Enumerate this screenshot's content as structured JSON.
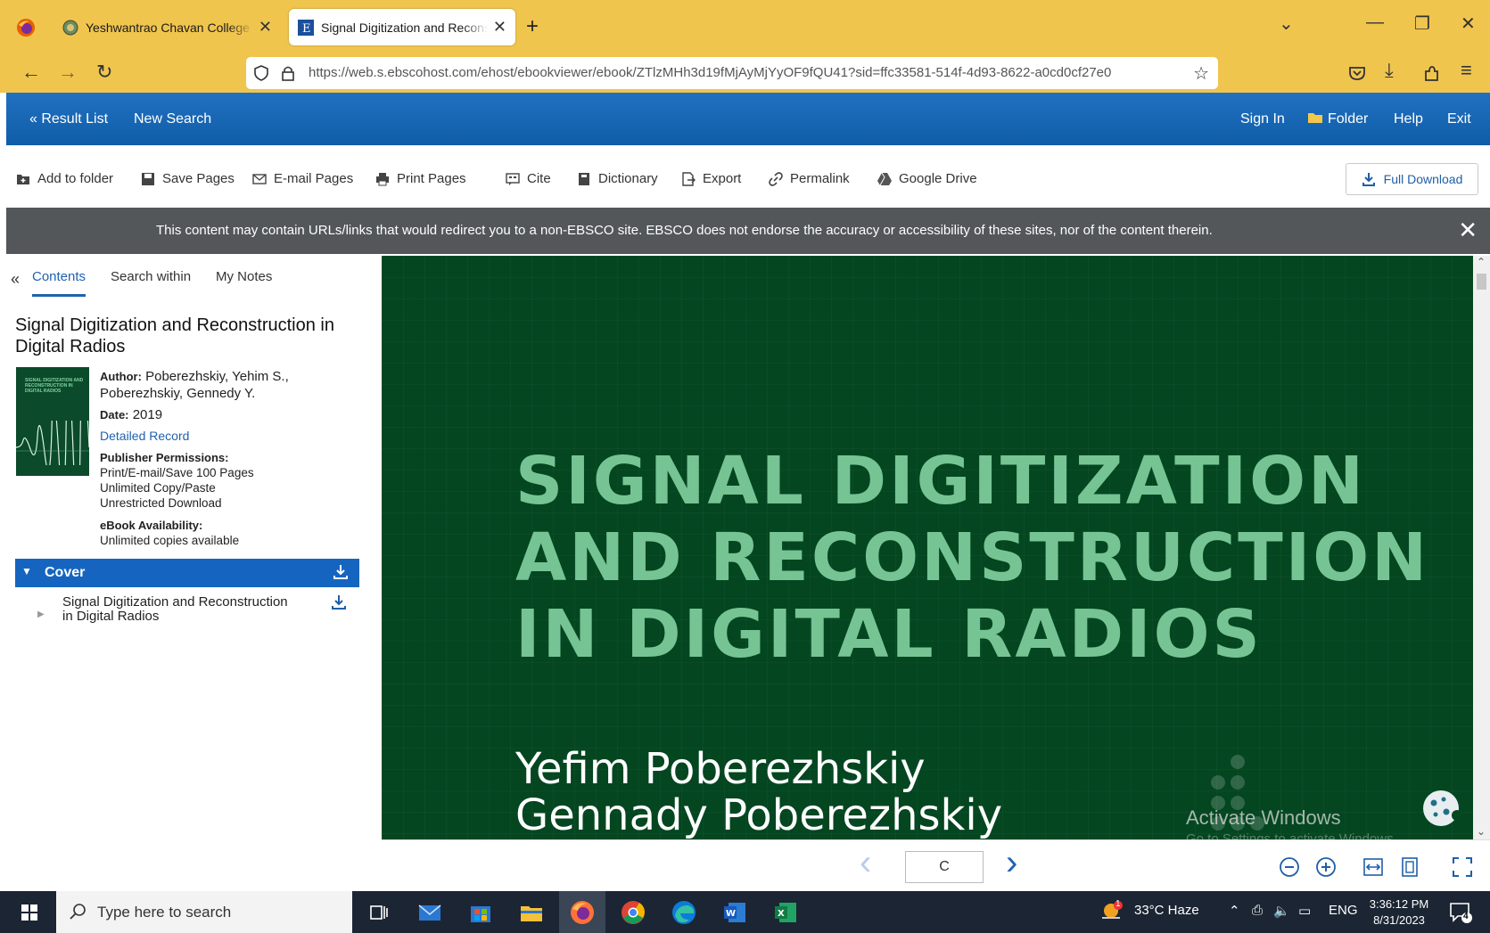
{
  "browser": {
    "tabs": [
      {
        "title": "Yeshwantrao Chavan College of Engineering",
        "active": false
      },
      {
        "title": "Signal Digitization and Reconstruction in Digital Radios",
        "active": true
      }
    ],
    "url": "https://web.s.ebscohost.com/ehost/ebookviewer/ebook/ZTlzMHh3d19fMjAyMjYyOF9fQU41?sid=ffc33581-514f-4d93-8622-a0cd0cf27e0"
  },
  "ebsco_header": {
    "result_list": "« Result List",
    "new_search": "New Search",
    "sign_in": "Sign In",
    "folder": "Folder",
    "help": "Help",
    "exit": "Exit"
  },
  "toolbar": {
    "add_to_folder": "Add to folder",
    "save_pages": "Save Pages",
    "email_pages": "E-mail Pages",
    "print_pages": "Print Pages",
    "cite": "Cite",
    "dictionary": "Dictionary",
    "export": "Export",
    "permalink": "Permalink",
    "google_drive": "Google Drive",
    "full_download": "Full Download"
  },
  "notice": "This content may contain URLs/links that would redirect you to a non-EBSCO site. EBSCO does not endorse the accuracy or accessibility of these sites, nor of the content therein.",
  "panel": {
    "tabs": [
      "Contents",
      "Search within",
      "My Notes"
    ],
    "book_title": "Signal Digitization and Reconstruction in Digital Radios",
    "cover_thumb_text": "SIGNAL DIGITIZATION AND RECONSTRUCTION IN DIGITAL RADIOS",
    "author_label": "Author:",
    "author_value": "Poberezhskiy, Yehim S., Poberezhskiy, Gennedy Y.",
    "date_label": "Date:",
    "date_value": "2019",
    "detailed_record": "Detailed Record",
    "permissions_label": "Publisher Permissions:",
    "permissions": [
      "Print/E-mail/Save 100 Pages",
      "Unlimited Copy/Paste",
      "Unrestricted Download"
    ],
    "availability_label": "eBook Availability:",
    "availability_value": "Unlimited copies available",
    "toc": {
      "section": "Cover",
      "item": "Signal Digitization and Reconstruction in Digital Radios"
    }
  },
  "viewer": {
    "title_lines": [
      "SIGNAL DIGITIZATION",
      "AND RECONSTRUCTION",
      "IN DIGITAL RADIOS"
    ],
    "author_lines": [
      "Yefim Poberezhskiy",
      "Gennady Poberezhskiy"
    ],
    "page_input": "C",
    "watermark_title": "Activate Windows",
    "watermark_sub": "Go to Settings to activate Windows."
  },
  "taskbar": {
    "search_placeholder": "Type here to search",
    "weather": "33°C  Haze",
    "language": "ENG",
    "time": "3:36:12 PM",
    "date": "8/31/2023",
    "notification_count": "4",
    "weather_badge": "1"
  },
  "colors": {
    "browser_chrome": "#f0c54e",
    "ebsco_blue": "#1565c0",
    "cover_green": "#034620",
    "title_green": "#76c493"
  }
}
